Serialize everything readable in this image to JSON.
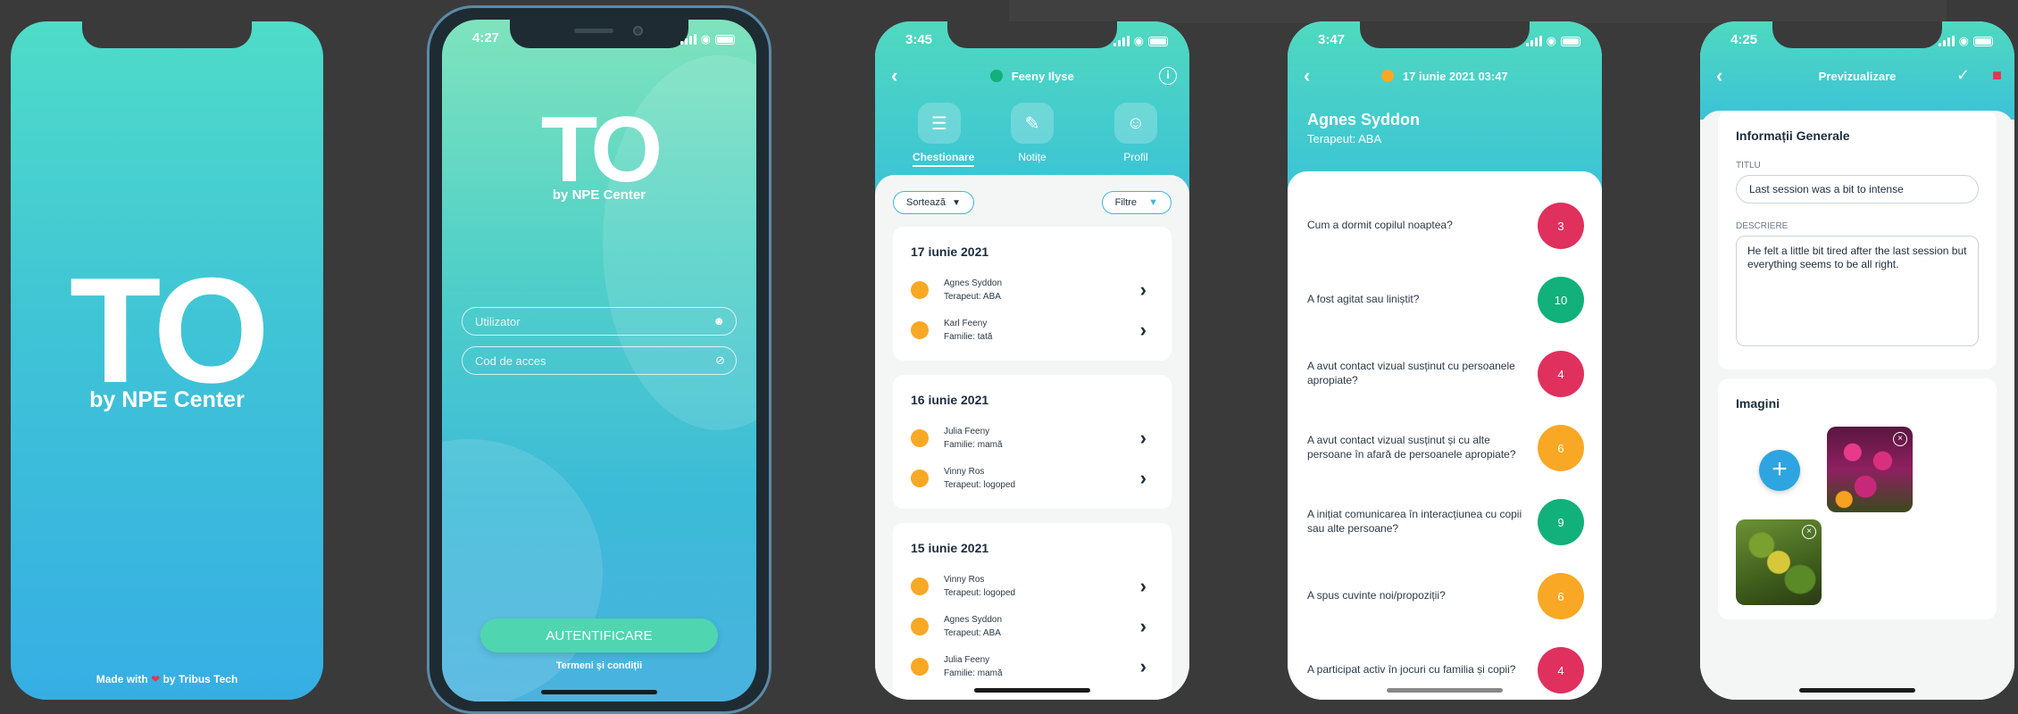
{
  "status": {
    "p1_time": "",
    "p2_time": "4:27",
    "p3_time": "3:45",
    "p4_time": "3:47",
    "p5_time": "4:25"
  },
  "brand": {
    "logo": "TO",
    "subtitle": "by NPE Center",
    "made_with_prefix": "Made with",
    "made_with_suffix": "by Tribus Tech"
  },
  "login": {
    "user_placeholder": "Utilizator",
    "code_placeholder": "Cod de acces",
    "button": "AUTENTIFICARE",
    "terms": "Termeni și condiții"
  },
  "client": {
    "name": "Feeny Ilyse",
    "tabs": [
      {
        "label": "Chestionare"
      },
      {
        "label": "Notițe"
      },
      {
        "label": "Profil"
      }
    ],
    "sort_label": "Sortează",
    "filter_label": "Filtre",
    "days": [
      {
        "title": "17 iunie 2021",
        "entries": [
          {
            "name": "Agnes Syddon",
            "role": "Terapeut: ABA"
          },
          {
            "name": "Karl Feeny",
            "role": "Familie: tată"
          }
        ]
      },
      {
        "title": "16 iunie 2021",
        "entries": [
          {
            "name": "Julia Feeny",
            "role": "Familie: mamă"
          },
          {
            "name": "Vinny Ros",
            "role": "Terapeut: logoped"
          }
        ]
      },
      {
        "title": "15 iunie 2021",
        "entries": [
          {
            "name": "Vinny Ros",
            "role": "Terapeut: logoped"
          },
          {
            "name": "Agnes Syddon",
            "role": "Terapeut: ABA"
          },
          {
            "name": "Julia Feeny",
            "role": "Familie: mamă"
          }
        ]
      }
    ]
  },
  "questionnaire": {
    "date": "17 iunie 2021 03:47",
    "therapist_name": "Agnes Syddon",
    "therapist_role": "Terapeut: ABA",
    "questions": [
      {
        "text": "Cum a dormit copilul noaptea?",
        "score": "3",
        "color": "#e0305e"
      },
      {
        "text": "A fost agitat sau liniștit?",
        "score": "10",
        "color": "#12b07a"
      },
      {
        "text": "A avut contact vizual susținut cu persoanele apropiate?",
        "score": "4",
        "color": "#e0305e"
      },
      {
        "text": "A avut contact vizual susținut și cu alte persoane în afară de persoanele apropiate?",
        "score": "6",
        "color": "#f9a825"
      },
      {
        "text": "A inițiat comunicarea în interacțiunea cu copii sau alte persoane?",
        "score": "9",
        "color": "#12b07a"
      },
      {
        "text": "A spus cuvinte noi/propoziții?",
        "score": "6",
        "color": "#f9a825"
      },
      {
        "text": "A participat activ în jocuri cu familia și copii?",
        "score": "4",
        "color": "#e0305e"
      }
    ]
  },
  "preview": {
    "title": "Previzualizare",
    "general_section": "Informații Generale",
    "title_label": "TITLU",
    "title_value": "Last session was a bit to intense",
    "desc_label": "DESCRIERE",
    "desc_value": "He felt a little bit tired after the last session but everything seems to be all right.",
    "images_section": "Imagini"
  },
  "colors": {
    "accent_teal": "#4fd9bf",
    "accent_blue": "#2ea5e0",
    "orange": "#f9a825",
    "red": "#e0305e",
    "green": "#12b07a"
  }
}
